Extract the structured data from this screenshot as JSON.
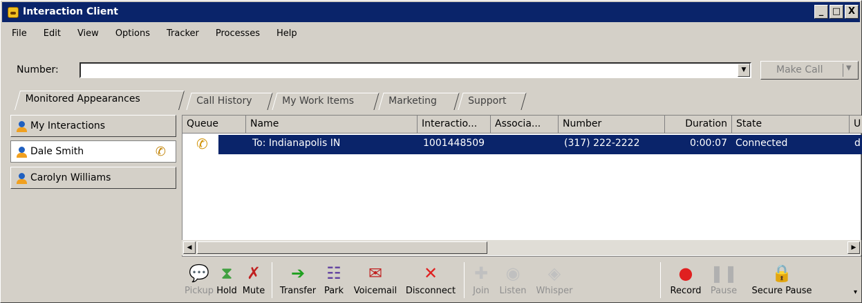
{
  "window": {
    "title": "Interaction Client",
    "buttons": [
      "_",
      "□",
      "X"
    ]
  },
  "menu": [
    "File",
    "Edit",
    "View",
    "Options",
    "Tracker",
    "Processes",
    "Help"
  ],
  "number_bar": {
    "label": "Number:",
    "value": "",
    "make_call": "Make Call"
  },
  "tabs": [
    "Monitored Appearances",
    "Call History",
    "My Work Items",
    "Marketing",
    "Support"
  ],
  "sidebar": [
    {
      "label": "My Interactions"
    },
    {
      "label": "Dale Smith"
    },
    {
      "label": "Carolyn Williams"
    }
  ],
  "grid": {
    "columns": [
      "Queue",
      "Name",
      "Interactio...",
      "Associa...",
      "Number",
      "Duration",
      "State",
      "U"
    ],
    "row": {
      "name": "To: Indianapolis IN",
      "interaction": "1001448509",
      "number": "(317) 222-2222",
      "duration": "0:00:07",
      "state": "Connected",
      "user": "d"
    }
  },
  "toolbar": [
    {
      "label": "Pickup",
      "icon": "pickup-icon",
      "enabled": false
    },
    {
      "label": "Hold",
      "icon": "hourglass-icon",
      "enabled": true
    },
    {
      "label": "Mute",
      "icon": "microphone-mute-icon",
      "enabled": true
    },
    {
      "label": "Transfer",
      "icon": "transfer-icon",
      "enabled": true
    },
    {
      "label": "Park",
      "icon": "park-icon",
      "enabled": true
    },
    {
      "label": "Voicemail",
      "icon": "voicemail-icon",
      "enabled": true
    },
    {
      "label": "Disconnect",
      "icon": "disconnect-icon",
      "enabled": true
    },
    {
      "label": "Join",
      "icon": "join-icon",
      "enabled": false
    },
    {
      "label": "Listen",
      "icon": "listen-icon",
      "enabled": false
    },
    {
      "label": "Whisper",
      "icon": "whisper-icon",
      "enabled": false
    },
    {
      "label": "Record",
      "icon": "record-icon",
      "enabled": true
    },
    {
      "label": "Pause",
      "icon": "pause-icon",
      "enabled": false
    },
    {
      "label": "Secure Pause",
      "icon": "secure-pause-icon",
      "enabled": true
    }
  ],
  "colors": {
    "titlebar": "#0a246a",
    "selection": "#0a246a",
    "chrome": "#d4d0c8",
    "record": "#e02020"
  }
}
